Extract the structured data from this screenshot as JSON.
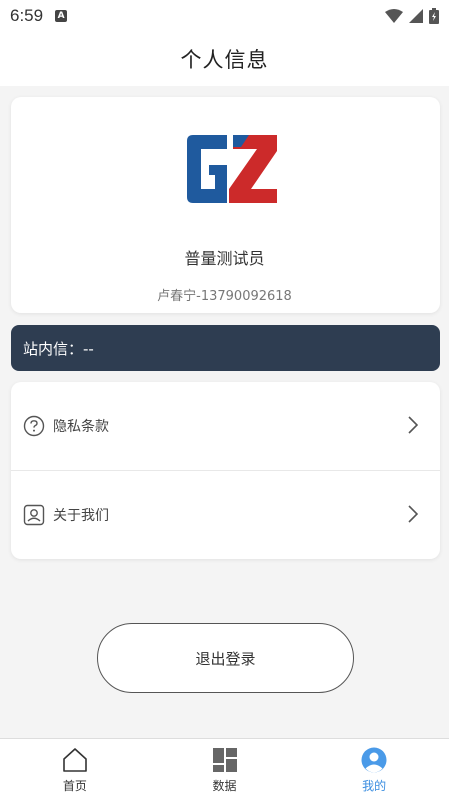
{
  "status_bar": {
    "time": "6:59",
    "notification_badge": "A"
  },
  "header": {
    "title": "个人信息"
  },
  "profile": {
    "logo_text": "GZ",
    "name": "普量测试员",
    "subtitle": "卢春宁-13790092618"
  },
  "message": {
    "label": "站内信：--"
  },
  "menu": {
    "items": [
      {
        "label": "隐私条款",
        "icon": "question-circle-icon"
      },
      {
        "label": "关于我们",
        "icon": "person-card-icon"
      }
    ]
  },
  "logout": {
    "label": "退出登录"
  },
  "tabbar": {
    "tabs": [
      {
        "label": "首页",
        "icon": "home-icon"
      },
      {
        "label": "数据",
        "icon": "data-grid-icon"
      },
      {
        "label": "我的",
        "icon": "user-avatar-icon"
      }
    ],
    "active_index": 2
  },
  "colors": {
    "message_bg": "#2e3d51",
    "logo_blue": "#1f5a9e",
    "logo_red": "#cc2a2a",
    "tab_active": "#3a8de0"
  }
}
